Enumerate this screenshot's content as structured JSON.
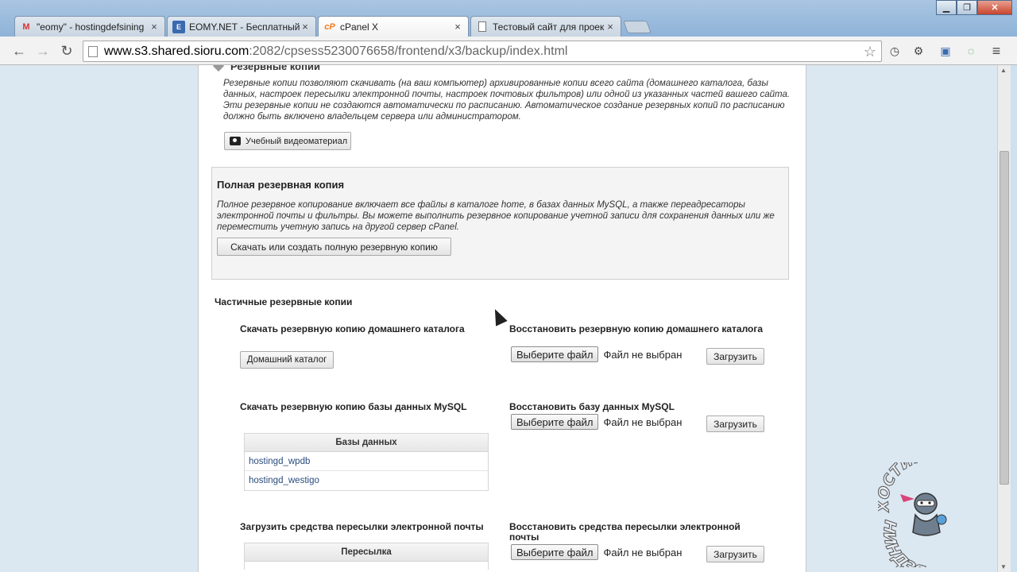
{
  "browser": {
    "tabs": [
      {
        "icon": "gmail-icon",
        "title": "\"eomy\" - hostingdefsining",
        "close": "×"
      },
      {
        "icon": "site-icon",
        "title": "EOMY.NET - Бесплатный",
        "close": "×"
      },
      {
        "icon": "cpanel-icon",
        "title": "cPanel X",
        "close": "×",
        "active": true
      },
      {
        "icon": "page-icon",
        "title": "Тестовый сайт для проек",
        "close": "×"
      }
    ],
    "cpanel_fav": "cP",
    "url_host": "www.s3.shared.sioru.com",
    "url_path": ":2082/cpsess5230076658/frontend/x3/backup/index.html"
  },
  "page": {
    "cut_section_title": "Резервные копии",
    "description": "Резервные копии позволяют скачивать (на ваш компьютер) архивированные копии всего сайта (домашнего каталога, базы данных, настроек пересылки электронной почты, настроек почтовых фильтров) или одной из указанных частей вашего сайта. Эти резервные копии не создаются автоматически по расписанию. Автоматическое создание резервных копий по расписанию должно быть включено владельцем сервера или администратором.",
    "video_button": "Учебный видеоматериал",
    "full_backup": {
      "title": "Полная резервная копия",
      "description": "Полное резервное копирование включает все файлы в каталоге home, в базах данных MySQL, а также переадресаторы электронной почты и фильтры. Вы можете выполнить резервное копирование учетной записи для сохранения данных или же переместить учетную запись на другой сервер cPanel.",
      "button": "Скачать или создать полную резервную копию"
    },
    "partial": {
      "title": "Частичные резервные копии",
      "home_download_title": "Скачать резервную копию домашнего каталога",
      "home_button": "Домашний каталог",
      "home_restore_title": "Восстановить резервную копию домашнего каталога",
      "choose_file": "Выберите файл",
      "no_file": "Файл не выбран",
      "upload": "Загрузить",
      "mysql_download_title": "Скачать резервную копию базы данных MySQL",
      "mysql_restore_title": "Восстановить базу данных MySQL",
      "db_table_header": "Базы данных",
      "databases": [
        "hostingd_wpdb",
        "hostingd_westigo"
      ],
      "fwd_download_title": "Загрузить средства пересылки электронной почты",
      "fwd_restore_title": "Восстановить средства пересылки электронной почты",
      "fwd_table_header": "Пересылка"
    }
  },
  "watermark": {
    "top_text": "ХОСТИНГ-",
    "bottom_text": "НИНДЗЯ"
  }
}
